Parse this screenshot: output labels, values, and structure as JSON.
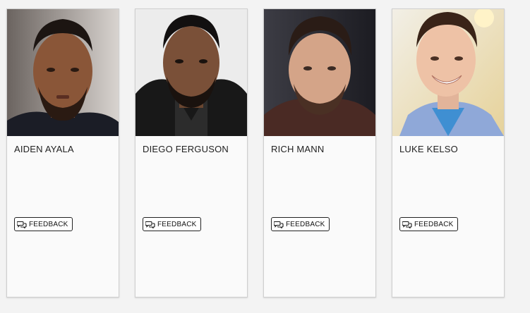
{
  "cards": [
    {
      "name": "AIDEN AYALA",
      "feedback_label": "FEEDBACK",
      "photo_icon": "headshot-photo"
    },
    {
      "name": "DIEGO FERGUSON",
      "feedback_label": "FEEDBACK",
      "photo_icon": "headshot-photo"
    },
    {
      "name": "RICH MANN",
      "feedback_label": "FEEDBACK",
      "photo_icon": "headshot-photo"
    },
    {
      "name": "LUKE KELSO",
      "feedback_label": "FEEDBACK",
      "photo_icon": "headshot-photo"
    }
  ],
  "icons": {
    "feedback": "speech-bubbles-icon"
  },
  "colors": {
    "page_background": "#f3f3f3",
    "card_background": "#fafafa",
    "card_border": "#cfcfcf",
    "text": "#222222"
  }
}
